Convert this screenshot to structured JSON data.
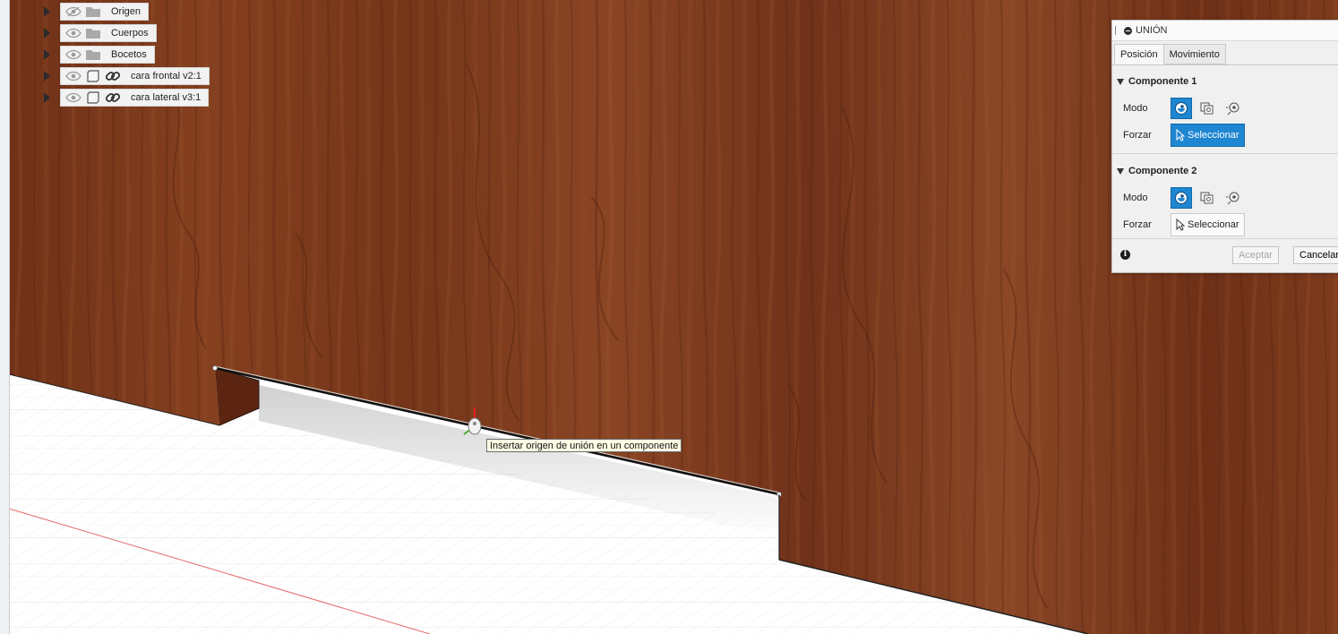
{
  "browser": {
    "items": [
      {
        "label": "Origen",
        "visibility": "hidden-eye-icon",
        "type": "folder-icon"
      },
      {
        "label": "Cuerpos",
        "visibility": "eye-icon",
        "type": "folder-icon"
      },
      {
        "label": "Bocetos",
        "visibility": "eye-icon",
        "type": "folder-icon"
      },
      {
        "label": "cara frontal v2:1",
        "visibility": "eye-icon",
        "type": "component-icon",
        "link": "link-icon"
      },
      {
        "label": "cara lateral v3:1",
        "visibility": "eye-icon",
        "type": "component-icon",
        "link": "link-icon"
      }
    ]
  },
  "viewport": {
    "tooltip": "Insertar origen de unión en un componente",
    "wood_color": "#7a3a1c",
    "grid_color": "#e4e6e8",
    "axis_color": "#e05050"
  },
  "dialog": {
    "title": "UNIÓN",
    "tabs": [
      {
        "label": "Posición",
        "active": true
      },
      {
        "label": "Movimiento",
        "active": false
      }
    ],
    "component1": {
      "title": "Componente 1",
      "mode_label": "Modo",
      "force_label": "Forzar",
      "select_label": "Seleccionar",
      "select_active": true
    },
    "component2": {
      "title": "Componente 2",
      "mode_label": "Modo",
      "force_label": "Forzar",
      "select_label": "Seleccionar",
      "select_active": false
    },
    "accept_label": "Aceptar",
    "cancel_label": "Cancelar",
    "accent": "#1f86d1"
  }
}
